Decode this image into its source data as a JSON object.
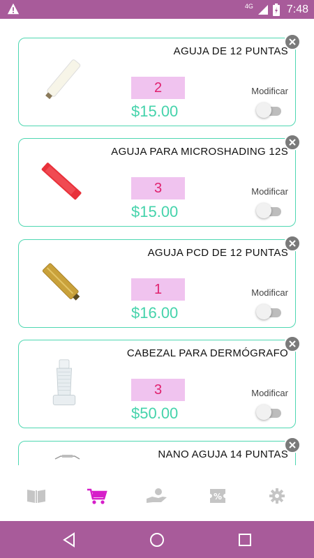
{
  "status_bar": {
    "network": "4G",
    "time": "7:48"
  },
  "cart_items": [
    {
      "title": "AGUJA DE 12 PUNTAS",
      "quantity": "2",
      "price": "$15.00",
      "modify_label": "Modificar",
      "image": "white-needle-cartridge"
    },
    {
      "title": "AGUJA PARA MICROSHADING 12S",
      "quantity": "3",
      "price": "$15.00",
      "modify_label": "Modificar",
      "image": "red-needle-cartridge"
    },
    {
      "title": "AGUJA PCD DE 12 PUNTAS",
      "quantity": "1",
      "price": "$16.00",
      "modify_label": "Modificar",
      "image": "gold-needle-cartridge"
    },
    {
      "title": "CABEZAL PARA DERMÓGRAFO",
      "quantity": "3",
      "price": "$50.00",
      "modify_label": "Modificar",
      "image": "clear-dermograph-head"
    },
    {
      "title": "NANO AGUJA 14 PUNTAS",
      "image": "nano-needle"
    }
  ],
  "bottom_nav": {
    "items": [
      {
        "icon": "book-icon",
        "active": false
      },
      {
        "icon": "cart-icon",
        "active": true
      },
      {
        "icon": "hand-money-icon",
        "active": false
      },
      {
        "icon": "discount-tag-icon",
        "active": false
      },
      {
        "icon": "gear-icon",
        "active": false
      }
    ]
  },
  "colors": {
    "status_bar": "#a85b9a",
    "card_border": "#4ed7b1",
    "quantity_bg": "#f0c3ef",
    "quantity_text": "#e0226f",
    "price_text": "#45d3ab",
    "nav_active": "#d61ec9",
    "nav_inactive": "#c5c5c5"
  }
}
